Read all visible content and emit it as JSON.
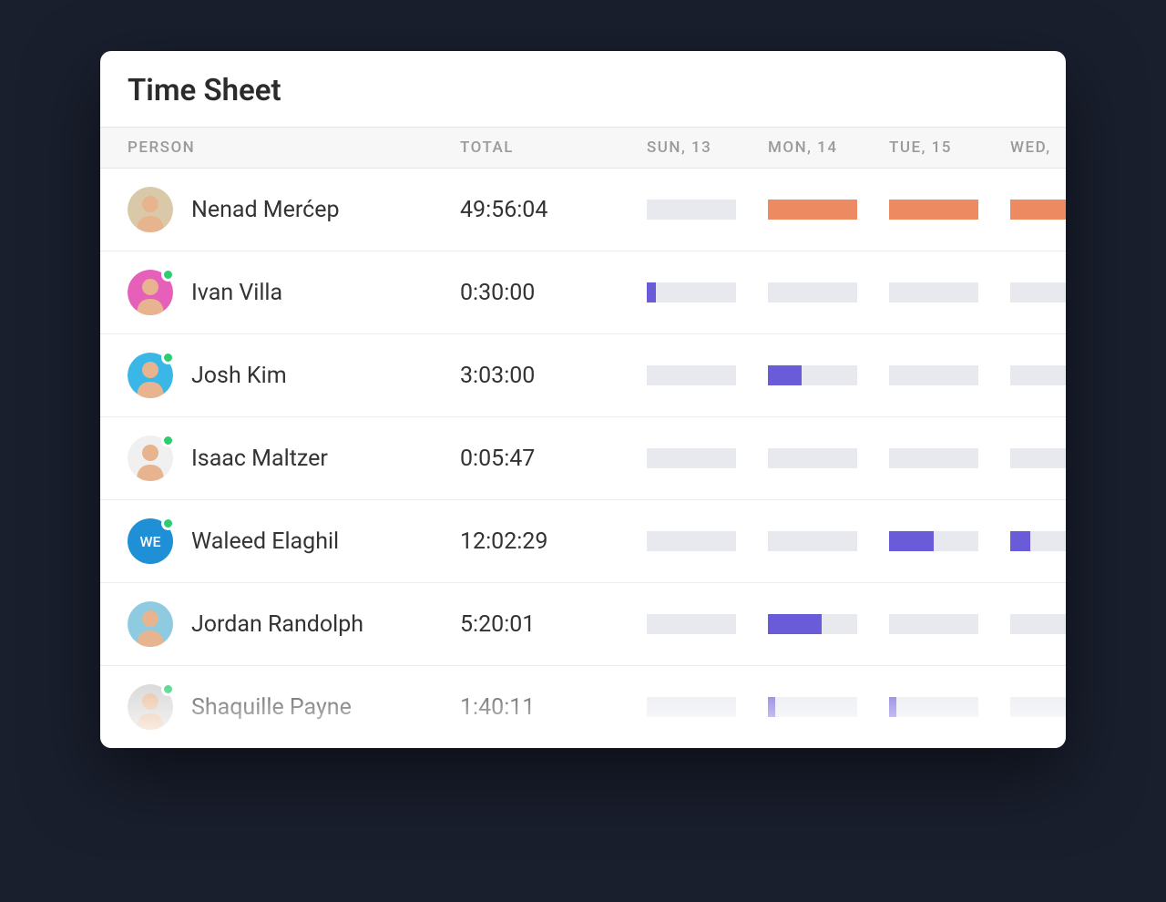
{
  "title": "Time Sheet",
  "headers": {
    "person": "PERSON",
    "total": "TOTAL",
    "days": [
      "SUN, 13",
      "MON, 14",
      "TUE, 15",
      "WED,"
    ]
  },
  "colors": {
    "orange": "#ed8a61",
    "purple": "#6a5cd8",
    "track": "#e8e9ef",
    "online": "#2ecc71"
  },
  "rows": [
    {
      "name": "Nenad Merćep",
      "total": "49:56:04",
      "online": false,
      "avatar": {
        "type": "photo",
        "bg": "#d9c9a8"
      },
      "bars": [
        {
          "fill": 0,
          "color": "orange"
        },
        {
          "fill": 100,
          "color": "orange"
        },
        {
          "fill": 100,
          "color": "orange"
        },
        {
          "fill": 100,
          "color": "orange"
        }
      ]
    },
    {
      "name": "Ivan Villa",
      "total": "0:30:00",
      "online": true,
      "avatar": {
        "type": "photo",
        "bg": "#e65fb8"
      },
      "bars": [
        {
          "fill": 10,
          "color": "purple"
        },
        {
          "fill": 0,
          "color": "purple"
        },
        {
          "fill": 0,
          "color": "purple"
        },
        {
          "fill": 0,
          "color": "purple"
        }
      ]
    },
    {
      "name": "Josh Kim",
      "total": "3:03:00",
      "online": true,
      "avatar": {
        "type": "photo",
        "bg": "#3ab7e6"
      },
      "bars": [
        {
          "fill": 0,
          "color": "purple"
        },
        {
          "fill": 38,
          "color": "purple"
        },
        {
          "fill": 0,
          "color": "purple"
        },
        {
          "fill": 0,
          "color": "purple"
        }
      ]
    },
    {
      "name": "Isaac Maltzer",
      "total": "0:05:47",
      "online": true,
      "avatar": {
        "type": "photo",
        "bg": "#f0f0f0"
      },
      "bars": [
        {
          "fill": 0,
          "color": "purple"
        },
        {
          "fill": 0,
          "color": "purple"
        },
        {
          "fill": 0,
          "color": "purple"
        },
        {
          "fill": 0,
          "color": "purple"
        }
      ]
    },
    {
      "name": "Waleed Elaghil",
      "total": "12:02:29",
      "online": true,
      "avatar": {
        "type": "initials",
        "initials": "WE",
        "bg": "#1f8fd6"
      },
      "bars": [
        {
          "fill": 0,
          "color": "purple"
        },
        {
          "fill": 0,
          "color": "purple"
        },
        {
          "fill": 50,
          "color": "purple"
        },
        {
          "fill": 22,
          "color": "purple"
        }
      ]
    },
    {
      "name": "Jordan Randolph",
      "total": "5:20:01",
      "online": false,
      "avatar": {
        "type": "photo",
        "bg": "#8ecbe0"
      },
      "bars": [
        {
          "fill": 0,
          "color": "purple"
        },
        {
          "fill": 60,
          "color": "purple"
        },
        {
          "fill": 0,
          "color": "purple"
        },
        {
          "fill": 0,
          "color": "purple"
        }
      ]
    },
    {
      "name": "Shaquille Payne",
      "total": "1:40:11",
      "online": true,
      "avatar": {
        "type": "photo",
        "bg": "#d0d0d0"
      },
      "bars": [
        {
          "fill": 0,
          "color": "purple"
        },
        {
          "fill": 8,
          "color": "purple"
        },
        {
          "fill": 8,
          "color": "purple"
        },
        {
          "fill": 0,
          "color": "purple"
        }
      ]
    }
  ]
}
